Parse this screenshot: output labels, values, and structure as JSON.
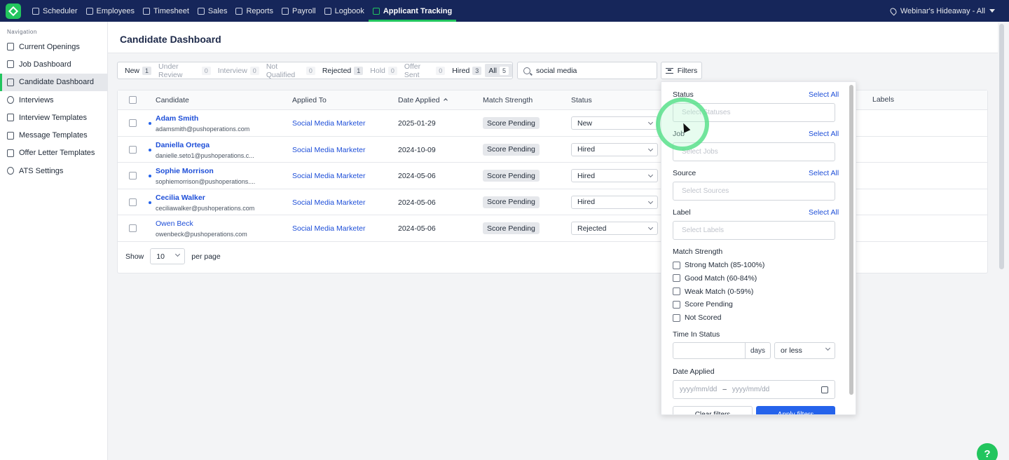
{
  "nav": {
    "items": [
      {
        "label": "Scheduler",
        "icon": "calendar-icon"
      },
      {
        "label": "Employees",
        "icon": "person-icon"
      },
      {
        "label": "Timesheet",
        "icon": "clock-icon"
      },
      {
        "label": "Sales",
        "icon": "building-icon"
      },
      {
        "label": "Reports",
        "icon": "chart-icon"
      },
      {
        "label": "Payroll",
        "icon": "money-icon"
      },
      {
        "label": "Logbook",
        "icon": "book-icon"
      },
      {
        "label": "Applicant Tracking",
        "icon": "clipboard-icon"
      }
    ],
    "active": "Applicant Tracking",
    "location": "Webinar's Hideaway - All"
  },
  "sidebar": {
    "heading": "Navigation",
    "items": [
      {
        "label": "Current Openings"
      },
      {
        "label": "Job Dashboard"
      },
      {
        "label": "Candidate Dashboard"
      },
      {
        "label": "Interviews"
      },
      {
        "label": "Interview Templates"
      },
      {
        "label": "Message Templates"
      },
      {
        "label": "Offer Letter Templates"
      },
      {
        "label": "ATS Settings"
      }
    ],
    "active": "Candidate Dashboard"
  },
  "page": {
    "title": "Candidate Dashboard"
  },
  "tabs": [
    {
      "label": "New",
      "count": "1"
    },
    {
      "label": "Under Review",
      "count": "0"
    },
    {
      "label": "Interview",
      "count": "0"
    },
    {
      "label": "Not Qualified",
      "count": "0"
    },
    {
      "label": "Rejected",
      "count": "1"
    },
    {
      "label": "Hold",
      "count": "0"
    },
    {
      "label": "Offer Sent",
      "count": "0"
    },
    {
      "label": "Hired",
      "count": "3"
    },
    {
      "label": "All",
      "count": "5"
    }
  ],
  "search": {
    "value": "social media"
  },
  "filters_button": "Filters",
  "table": {
    "headers": {
      "candidate": "Candidate",
      "applied_to": "Applied To",
      "date_applied": "Date Applied",
      "match": "Match Strength",
      "status": "Status",
      "labels": "Labels"
    },
    "rows": [
      {
        "name": "Adam Smith",
        "email": "adamsmith@pushoperations.com",
        "applied_to": "Social Media Marketer",
        "date": "2025-01-29",
        "match": "Score Pending",
        "status": "New",
        "unread": true
      },
      {
        "name": "Daniella Ortega",
        "email": "danielle.seto1@pushoperations.c...",
        "applied_to": "Social Media Marketer",
        "date": "2024-10-09",
        "match": "Score Pending",
        "status": "Hired",
        "unread": true
      },
      {
        "name": "Sophie Morrison",
        "email": "sophiemorrison@pushoperations....",
        "applied_to": "Social Media Marketer",
        "date": "2024-05-06",
        "match": "Score Pending",
        "status": "Hired",
        "unread": true
      },
      {
        "name": "Cecilia Walker",
        "email": "ceciliawalker@pushoperations.com",
        "applied_to": "Social Media Marketer",
        "date": "2024-05-06",
        "match": "Score Pending",
        "status": "Hired",
        "unread": true
      },
      {
        "name": "Owen Beck",
        "email": "owenbeck@pushoperations.com",
        "applied_to": "Social Media Marketer",
        "date": "2024-05-06",
        "match": "Score Pending",
        "status": "Rejected",
        "unread": false
      }
    ]
  },
  "pager": {
    "show": "Show",
    "per_page_value": "10",
    "per_page": "per page"
  },
  "filter_panel": {
    "status": {
      "title": "Status",
      "select_all": "Select All",
      "placeholder": "Select Statuses"
    },
    "job": {
      "title": "Job",
      "select_all": "Select All",
      "placeholder": "Select Jobs"
    },
    "source": {
      "title": "Source",
      "select_all": "Select All",
      "placeholder": "Select Sources"
    },
    "label": {
      "title": "Label",
      "select_all": "Select All",
      "placeholder": "Select Labels"
    },
    "match_strength": {
      "title": "Match Strength",
      "options": [
        "Strong Match (85-100%)",
        "Good Match (60-84%)",
        "Weak Match (0-59%)",
        "Score Pending",
        "Not Scored"
      ]
    },
    "time_in_status": {
      "title": "Time In Status",
      "unit": "days",
      "comparator": "or less"
    },
    "date_applied": {
      "title": "Date Applied",
      "from_placeholder": "yyyy/mm/dd",
      "separator": "–",
      "to_placeholder": "yyyy/mm/dd"
    },
    "clear": "Clear filters",
    "apply": "Apply filters"
  },
  "help": "?",
  "colors": {
    "topbar": "#16265a",
    "accent": "#22c55e",
    "link": "#1d4ed8",
    "primary_button": "#2563eb"
  }
}
